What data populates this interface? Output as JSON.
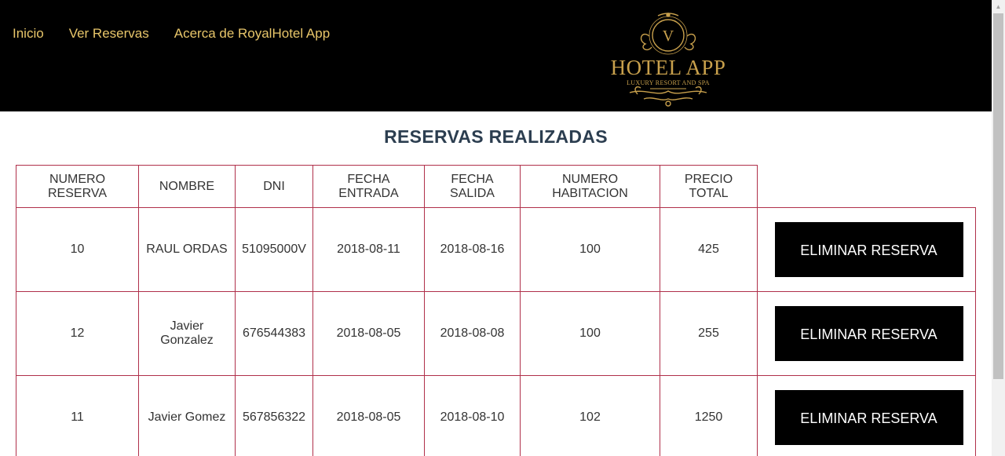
{
  "nav": {
    "items": [
      {
        "label": "Inicio"
      },
      {
        "label": "Ver Reservas"
      },
      {
        "label": "Acerca de RoyalHotel App"
      }
    ]
  },
  "logo": {
    "monogram": "V",
    "name": "HOTEL APP",
    "tagline": "LUXURY RESORT AND SPA",
    "color": "#c8a04c"
  },
  "page": {
    "title": "RESERVAS REALIZADAS"
  },
  "table": {
    "headers": [
      [
        "NUMERO",
        "RESERVA"
      ],
      [
        "NOMBRE",
        ""
      ],
      [
        "DNI",
        ""
      ],
      [
        "FECHA",
        "ENTRADA"
      ],
      [
        "FECHA",
        "SALIDA"
      ],
      [
        "NUMERO",
        "HABITACION"
      ],
      [
        "PRECIO",
        "TOTAL"
      ]
    ],
    "rows": [
      {
        "numero": "10",
        "nombre": "RAUL ORDAS",
        "dni": "51095000V",
        "entrada": "2018-08-11",
        "salida": "2018-08-16",
        "habitacion": "100",
        "precio": "425",
        "action": "ELIMINAR RESERVA"
      },
      {
        "numero": "12",
        "nombre": "Javier Gonzalez",
        "dni": "676544383",
        "entrada": "2018-08-05",
        "salida": "2018-08-08",
        "habitacion": "100",
        "precio": "255",
        "action": "ELIMINAR RESERVA"
      },
      {
        "numero": "11",
        "nombre": "Javier Gomez",
        "dni": "567856322",
        "entrada": "2018-08-05",
        "salida": "2018-08-10",
        "habitacion": "102",
        "precio": "1250",
        "action": "ELIMINAR RESERVA"
      }
    ]
  },
  "colors": {
    "nav_link": "#e8c66a",
    "header_bg": "#000000",
    "table_border": "#b0304a",
    "title": "#2c3e50"
  }
}
